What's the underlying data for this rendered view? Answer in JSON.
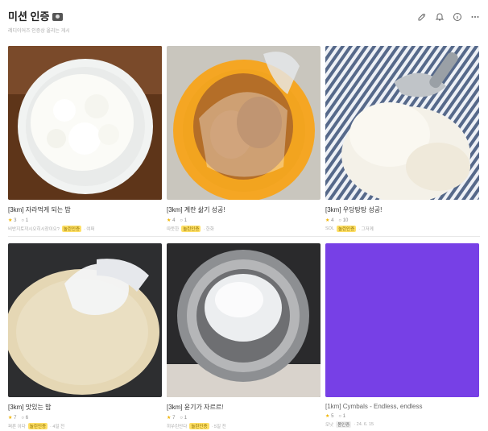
{
  "header": {
    "title": "미션 인증",
    "subtitle": "레디이어즈 인증상 올리는 게시"
  },
  "cards": [
    {
      "title": "[3km] 자라먹게 되는 밥",
      "stars": "3",
      "comments": "1",
      "meta_text": "비반지토끼시오히시장이오?",
      "badge": "놀린인증",
      "after": "· 여퍼"
    },
    {
      "title": "[3km] 계란 삶기 성공!",
      "stars": "4",
      "comments": "1",
      "meta_text": "따뜻한",
      "badge": "놀린인증",
      "after": "· 한화"
    },
    {
      "title": "[3km] 우당탕탕 성공!",
      "stars": "4",
      "comments": "10",
      "meta_text": "SOL",
      "badge": "놀린인증",
      "after": "· 그저께"
    },
    {
      "title": "[3km] 맛있는 밥",
      "stars": "7",
      "comments": "6",
      "meta_text": "퍼른 이다",
      "badge": "놀린인증",
      "after": "· 4일 전"
    },
    {
      "title": "[3km] 윤기가 자르르!",
      "stars": "7",
      "comments": "1",
      "meta_text": "히쑤린안다",
      "badge": "놀린인증",
      "after": "· 5일 전"
    },
    {
      "title": "[1km] Cymbals - Endless, endless",
      "stars": "5",
      "comments": "1",
      "meta_text": "모낫",
      "badge": "봄인증",
      "after": "· 24. 6. 15"
    }
  ]
}
